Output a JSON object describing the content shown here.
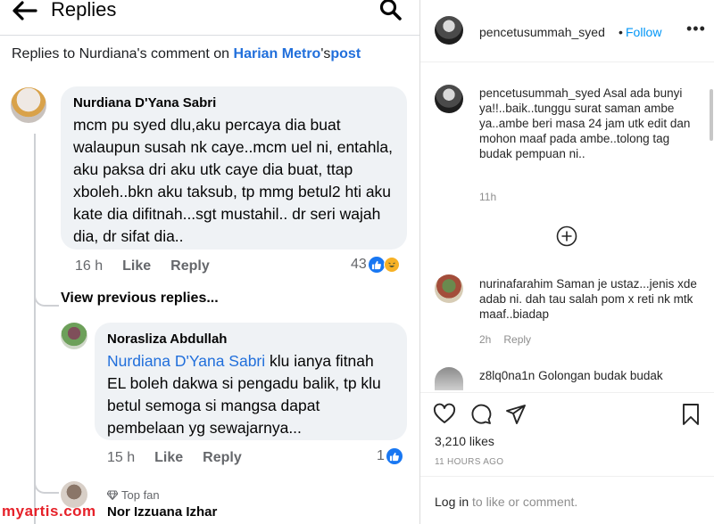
{
  "facebook": {
    "title": "Replies",
    "subtitle_prefix": "Replies to Nurdiana's comment on ",
    "subtitle_link_page": "Harian Metro",
    "subtitle_link_suffix": "'s",
    "subtitle_link_post": "post",
    "comment1": {
      "author": "Nurdiana D'Yana Sabri",
      "text": "mcm pu syed dlu,aku percaya dia buat walaupun susah nk caye..mcm uel ni, entahla, aku paksa dri aku utk caye dia buat, ttap xboleh..bkn aku taksub, tp mmg betul2 hti aku kate dia difitnah...sgt mustahil.. dr seri wajah dia, dr sifat dia..",
      "time": "16 h",
      "like": "Like",
      "reply": "Reply",
      "reactions": "43"
    },
    "view_previous": "View previous replies...",
    "comment2": {
      "author": "Norasliza Abdullah",
      "mention": "Nurdiana D'Yana Sabri",
      "text": " klu ianya fitnah EL boleh dakwa si pengadu balik, tp klu betul semoga si mangsa dapat pembelaan yg sewajarnya...",
      "time": "15 h",
      "like": "Like",
      "reply": "Reply",
      "reactions": "1"
    },
    "comment3": {
      "badge": "Top fan",
      "author": "Nor Izzuana Izhar"
    },
    "watermark": "myartis.com"
  },
  "instagram": {
    "username": "pencetusummah_syed",
    "dot": "•",
    "follow": "Follow",
    "more": "•••",
    "caption_user": "pencetusummah_syed",
    "caption_text": " Asal ada bunyi ya!!..baik..tunggu surat saman ambe ya..ambe beri masa 24 jam utk edit dan mohon maaf pada ambe..tolong tag budak pempuan ni..",
    "caption_time": "11h",
    "comments": [
      {
        "user": "nurinafarahim",
        "text": " Saman je ustaz...jenis xde adab ni. dah tau salah pom x reti nk mtk maaf..biadap",
        "time": "2h",
        "reply": "Reply"
      },
      {
        "user": "z8lq0na1n",
        "text": " Golongan budak budak"
      }
    ],
    "likes": "3,210 likes",
    "ago": "11 HOURS AGO",
    "login_link": "Log in",
    "login_text": " to like or comment."
  },
  "colors": {
    "fb_blue": "#1877f2",
    "fb_link": "#216fdb",
    "bubble_gray": "#eff2f5",
    "ig_blue": "#0095f6",
    "watermark_red": "#e62129"
  },
  "icons": [
    "back-arrow-icon",
    "search-icon",
    "like-reaction-icon",
    "haha-reaction-icon",
    "gem-icon",
    "add-comment-icon",
    "heart-icon",
    "comment-icon",
    "share-icon",
    "bookmark-icon"
  ]
}
